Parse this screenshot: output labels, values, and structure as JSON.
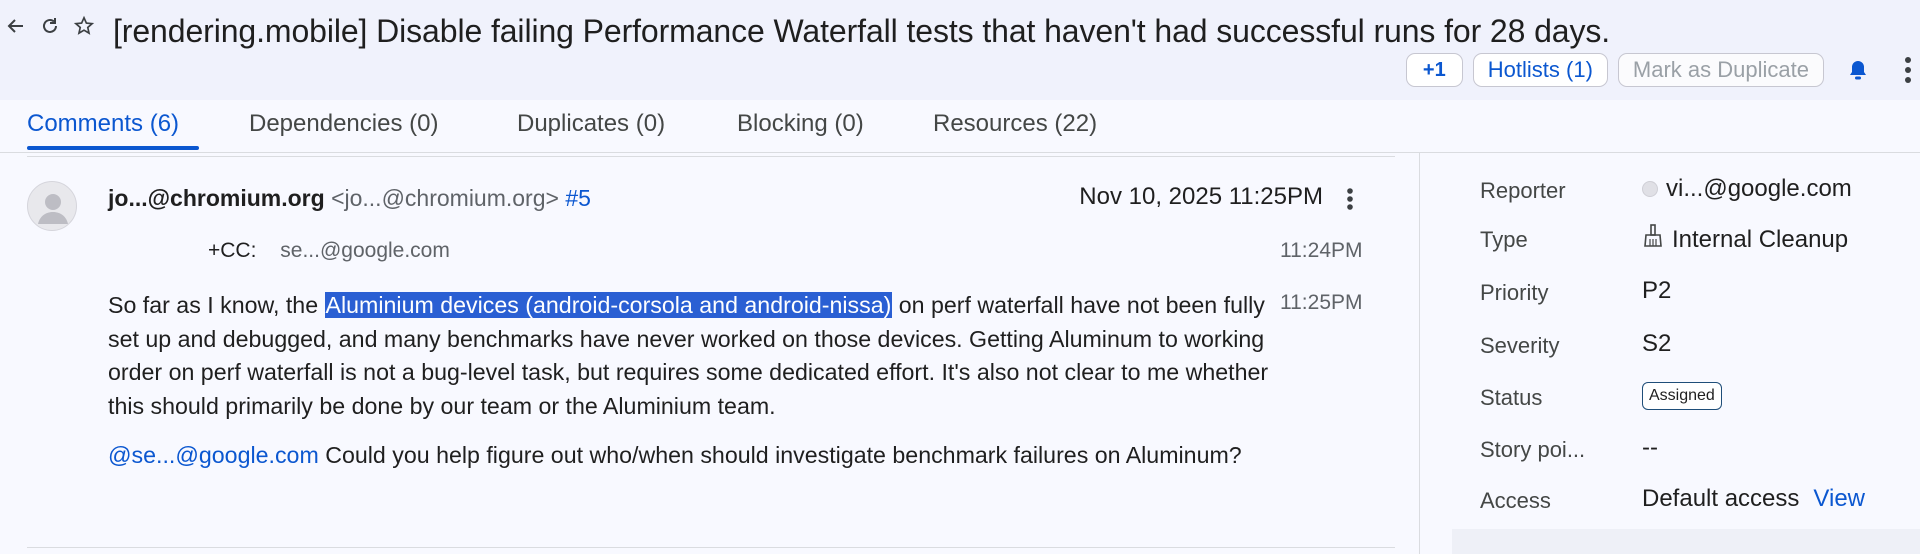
{
  "header": {
    "title": "[rendering.mobile] Disable failing Performance Waterfall tests that haven't had successful runs for 28 days.",
    "plus_one_label": "+1",
    "hotlists_label": "Hotlists (1)",
    "mark_duplicate_label": "Mark as Duplicate",
    "icons": [
      "back-arrow-icon",
      "reload-icon",
      "star-icon",
      "bell-icon",
      "more-vert-icon"
    ]
  },
  "tabs": [
    {
      "label": "Comments (6)",
      "active": true
    },
    {
      "label": "Dependencies (0)",
      "active": false
    },
    {
      "label": "Duplicates (0)",
      "active": false
    },
    {
      "label": "Blocking (0)",
      "active": false
    },
    {
      "label": "Resources (22)",
      "active": false
    }
  ],
  "comment": {
    "author_name": "jo...@chromium.org",
    "author_email": "<jo...@chromium.org>",
    "comment_number": "#5",
    "date": "Nov 10, 2025 11:25PM",
    "cc_label": "+CC:",
    "cc_value": "se...@google.com",
    "cc_time": "11:24PM",
    "body_time": "11:25PM",
    "para1_before": "So far as I know, the ",
    "para1_highlight": "Aluminium devices (android-corsola and android-nissa)",
    "para1_after": " on perf waterfall have not been fully set up and debugged, and many benchmarks have never worked on those devices. Getting Aluminum to working order on perf waterfall is not a bug-level task, but requires some dedicated effort. It's also not clear to me whether this should primarily be done by our team or the Aluminium team.",
    "mention": "@se...@google.com",
    "para2_after": " Could you help figure out who/when should investigate benchmark failures on Aluminum?"
  },
  "side": {
    "reporter_label": "Reporter",
    "reporter_value": "vi...@google.com",
    "type_label": "Type",
    "type_value": "Internal Cleanup",
    "priority_label": "Priority",
    "priority_value": "P2",
    "severity_label": "Severity",
    "severity_value": "S2",
    "status_label": "Status",
    "status_value": "Assigned",
    "story_label": "Story poi...",
    "story_value": "--",
    "access_label": "Access",
    "access_value": "Default access",
    "access_link": "View"
  },
  "colors": {
    "accent": "#0b57d0",
    "highlight": "#2a5fd3",
    "header_bg": "#f0f2fc"
  }
}
